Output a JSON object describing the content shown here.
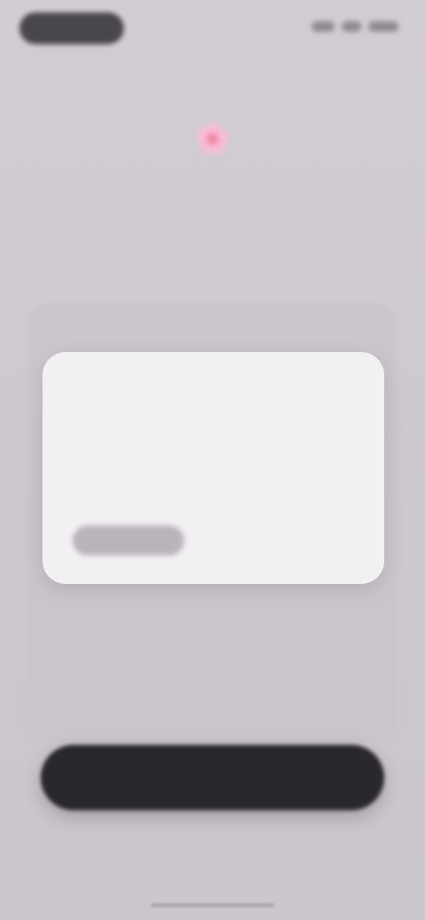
{
  "status_bar": {
    "time": "",
    "indicators": [
      "signal-icon",
      "wifi-icon",
      "battery-icon"
    ]
  },
  "header": {
    "app_name": "",
    "app_suffix": ""
  },
  "hero": {
    "title_line1": "",
    "title_line2": "",
    "title_emoji": "🌸",
    "subtitle": ""
  },
  "panel": {
    "caption": ""
  },
  "card": {
    "title": "",
    "body": "",
    "primary_action": "",
    "secondary_action": ""
  },
  "footer": {
    "cta_label": "",
    "secondary_link": ""
  },
  "colors": {
    "background": "#cdc8ce",
    "card": "#f2f0f3",
    "cta": "#2a282c",
    "text_dark": "#2a282c",
    "text_muted": "#8e8a90"
  }
}
